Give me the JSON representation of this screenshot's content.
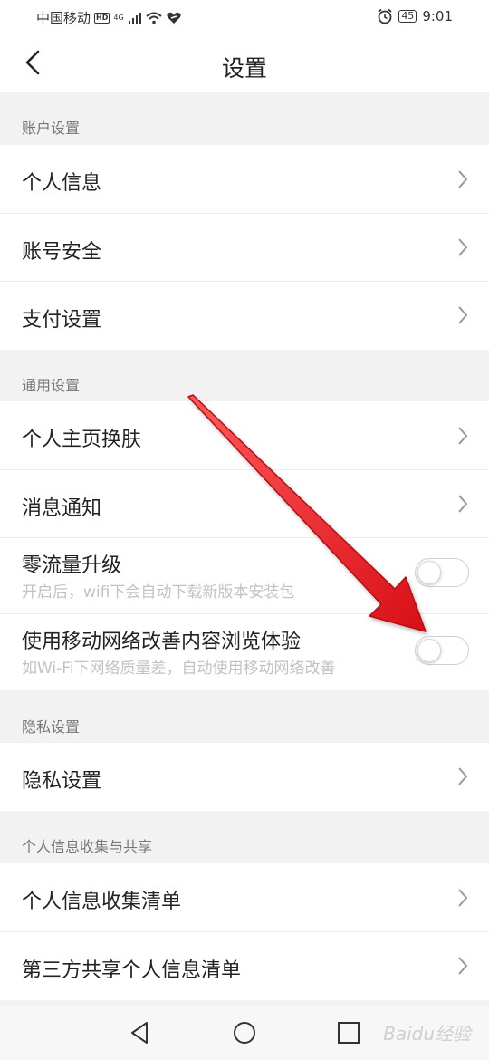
{
  "status_bar": {
    "carrier": "中国移动",
    "hd_badge": "HD",
    "network": "4G",
    "battery": "45",
    "time": "9:01"
  },
  "header": {
    "title": "设置"
  },
  "sections": [
    {
      "label": "账户设置"
    },
    {
      "label": "通用设置"
    },
    {
      "label": "隐私设置"
    },
    {
      "label": "个人信息收集与共享"
    }
  ],
  "rows": {
    "personal_info": "个人信息",
    "account_security": "账号安全",
    "payment_settings": "支付设置",
    "homepage_skin": "个人主页换肤",
    "notifications": "消息通知",
    "zero_data_upgrade": {
      "label": "零流量升级",
      "sub": "开启后，wifi下会自动下载新版本安装包",
      "enabled": false
    },
    "mobile_network_improve": {
      "label": "使用移动网络改善内容浏览体验",
      "sub": "如Wi-Fi下网络质量差，自动使用移动网络改善",
      "enabled": false
    },
    "privacy_settings": "隐私设置",
    "info_collection_list": "个人信息收集清单",
    "third_party_list": "第三方共享个人信息清单"
  },
  "watermark": "Baidu经验",
  "colors": {
    "background": "#f2f2f2",
    "row_bg": "#ffffff",
    "annotation_arrow": "#e8151b"
  },
  "icons": [
    "back-icon",
    "chevron-right-icon",
    "nav-back-icon",
    "nav-home-icon",
    "nav-recents-icon"
  ]
}
